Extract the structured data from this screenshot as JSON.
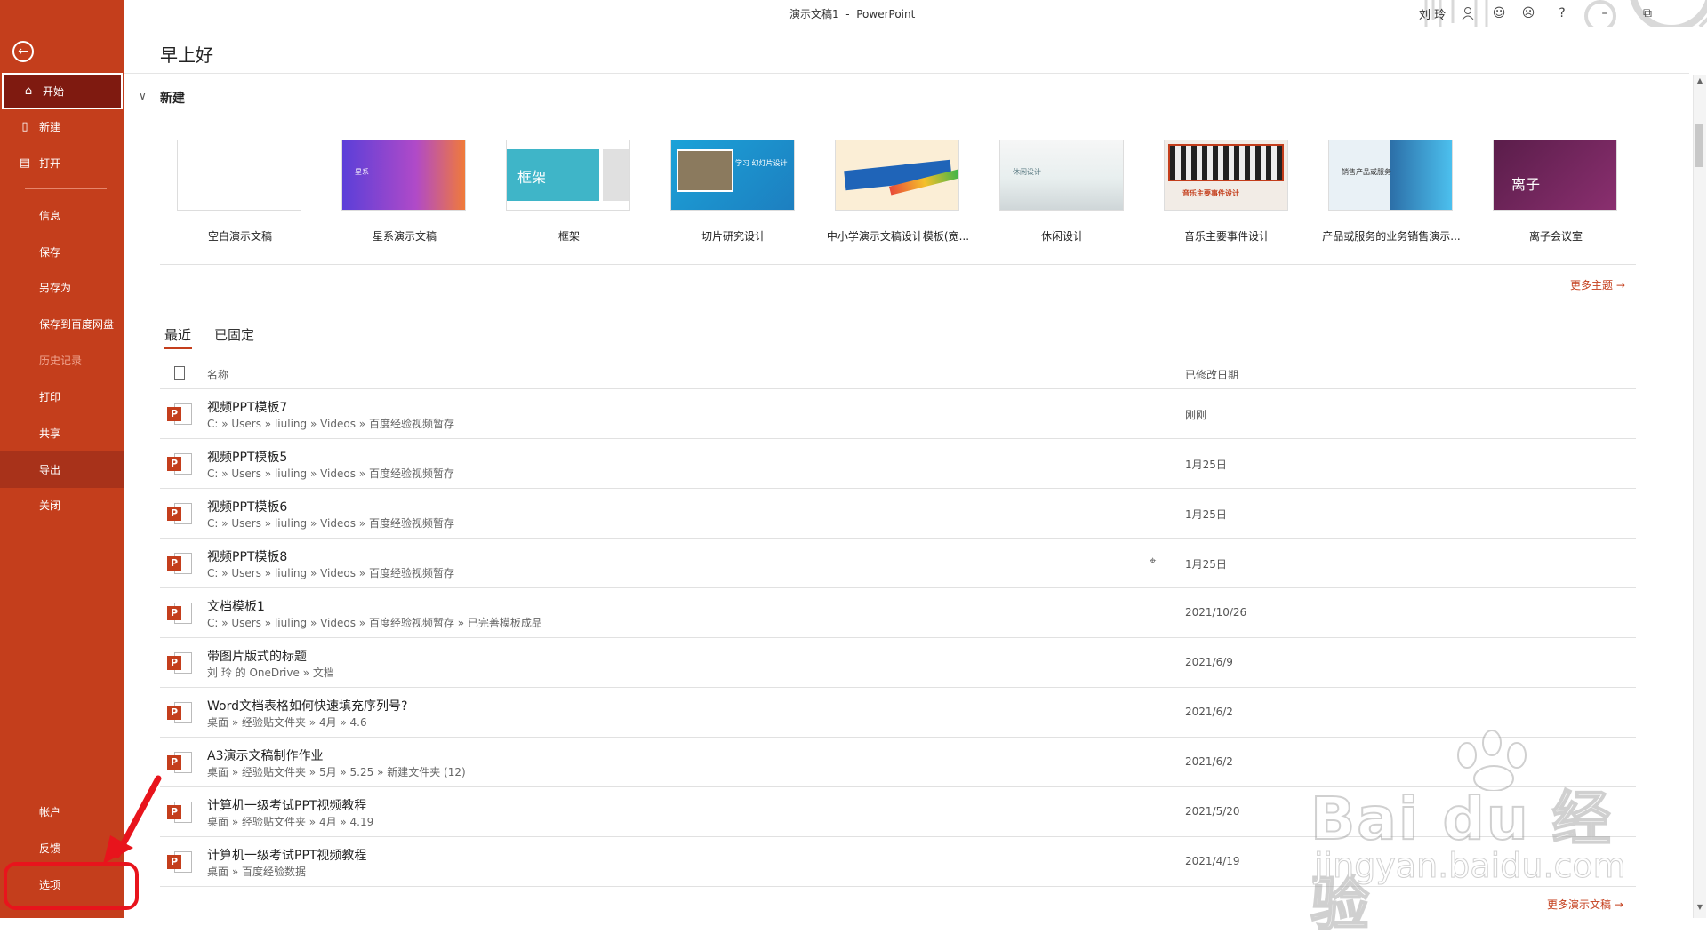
{
  "window": {
    "title": "演示文稿1  -  PowerPoint",
    "user_name": "刘 玲",
    "icons": [
      "person-icon",
      "smile-icon",
      "frown-icon",
      "help-icon",
      "minimize-icon",
      "restore-icon",
      "close-icon"
    ],
    "help_label": "?"
  },
  "sidebar": {
    "back_icon": "arrow-left-icon",
    "items": [
      {
        "label": "开始",
        "icon": "home-icon",
        "state": "active"
      },
      {
        "label": "新建",
        "icon": "file-icon"
      },
      {
        "label": "打开",
        "icon": "folder-open-icon"
      },
      {
        "label": "信息"
      },
      {
        "label": "保存"
      },
      {
        "label": "另存为"
      },
      {
        "label": "保存到百度网盘"
      },
      {
        "label": "历史记录",
        "state": "disabled"
      },
      {
        "label": "打印"
      },
      {
        "label": "共享"
      },
      {
        "label": "导出",
        "state": "hover"
      },
      {
        "label": "关闭"
      },
      {
        "label": "帐户"
      },
      {
        "label": "反馈"
      },
      {
        "label": "选项"
      }
    ],
    "accent": "#c43e1c"
  },
  "main": {
    "greeting": "早上好",
    "new_section": {
      "title": "新建",
      "templates": [
        {
          "name": "空白演示文稿",
          "thumb_text": ""
        },
        {
          "name": "星系演示文稿",
          "thumb_text": "星系"
        },
        {
          "name": "框架",
          "thumb_text": "框架"
        },
        {
          "name": "切片研究设计",
          "thumb_text": "学习 幻灯片设计"
        },
        {
          "name": "中小学演示文稿设计模板(宽...",
          "thumb_text": ""
        },
        {
          "name": "休闲设计",
          "thumb_text": "休闲设计"
        },
        {
          "name": "音乐主要事件设计",
          "thumb_text": "音乐主要事件设计"
        },
        {
          "name": "产品或服务的业务销售演示...",
          "thumb_text": "销售产品或服务"
        },
        {
          "name": "离子会议室",
          "thumb_text": "离子"
        }
      ],
      "more_label": "更多主题"
    },
    "tabs": [
      {
        "label": "最近",
        "active": true
      },
      {
        "label": "已固定",
        "active": false
      }
    ],
    "list": {
      "col_name": "名称",
      "col_date": "已修改日期",
      "rows": [
        {
          "name": "视频PPT模板7",
          "path": "C: » Users » liuling » Videos » 百度经验视频暂存",
          "date": "刚刚",
          "pinned": false
        },
        {
          "name": "视频PPT模板5",
          "path": "C: » Users » liuling » Videos » 百度经验视频暂存",
          "date": "1月25日",
          "pinned": false
        },
        {
          "name": "视频PPT模板6",
          "path": "C: » Users » liuling » Videos » 百度经验视频暂存",
          "date": "1月25日",
          "pinned": false
        },
        {
          "name": "视频PPT模板8",
          "path": "C: » Users » liuling » Videos » 百度经验视频暂存",
          "date": "1月25日",
          "pinned": true
        },
        {
          "name": "文档模板1",
          "path": "C: » Users » liuling » Videos » 百度经验视频暂存 » 已完善模板成品",
          "date": "2021/10/26",
          "pinned": false
        },
        {
          "name": "带图片版式的标题",
          "path": "刘 玲 的 OneDrive » 文档",
          "date": "2021/6/9",
          "pinned": false
        },
        {
          "name": "Word文档表格如何快速填充序列号?",
          "path": "桌面 » 经验贴文件夹 » 4月 » 4.6",
          "date": "2021/6/2",
          "pinned": false
        },
        {
          "name": "A3演示文稿制作作业",
          "path": "桌面 » 经验贴文件夹 » 5月 » 5.25 » 新建文件夹 (12)",
          "date": "2021/6/2",
          "pinned": false
        },
        {
          "name": "计算机一级考试PPT视频教程",
          "path": "桌面 » 经验贴文件夹 » 4月 » 4.19",
          "date": "2021/5/20",
          "pinned": false
        },
        {
          "name": "计算机一级考试PPT视频教程",
          "path": "桌面 » 百度经验数据",
          "date": "2021/4/19",
          "pinned": false
        }
      ],
      "more_label": "更多演示文稿",
      "pin_icon": "pin-icon",
      "file_icon": "powerpoint-file-icon",
      "file_badge": "P"
    }
  },
  "watermark": {
    "brand": "Bai du 经验",
    "url": "jingyan.baidu.com"
  }
}
